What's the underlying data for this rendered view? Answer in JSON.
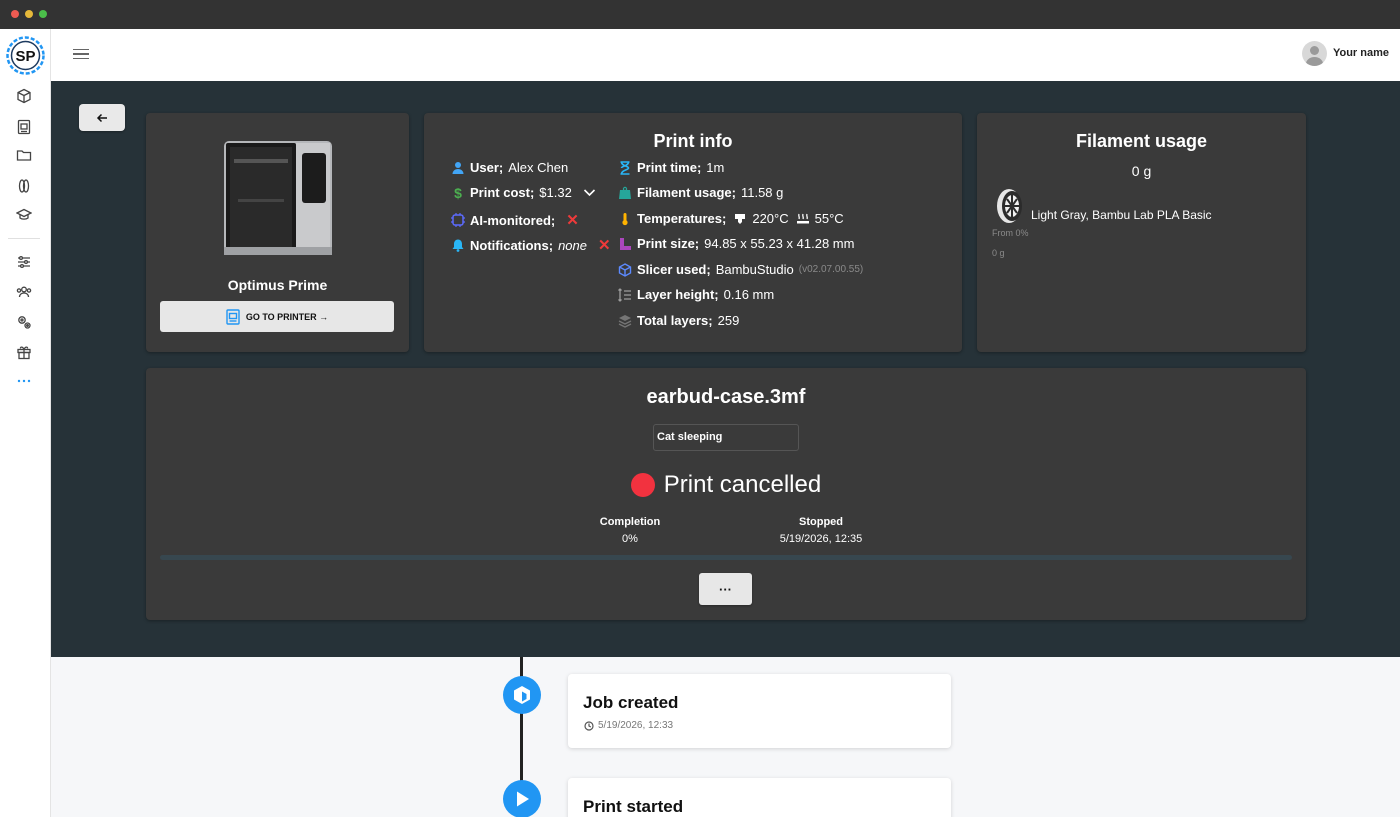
{
  "user": {
    "name": "Your name"
  },
  "printer": {
    "name": "Optimus Prime",
    "goto_label": "GO TO PRINTER →"
  },
  "print_info": {
    "title": "Print info",
    "user_label": "User;",
    "user_value": "Alex Chen",
    "cost_label": "Print cost;",
    "cost_value": "$1.32",
    "ai_label": "AI-monitored;",
    "notif_label": "Notifications;",
    "notif_value": "none",
    "time_label": "Print time;",
    "time_value": "1m",
    "filament_label": "Filament usage;",
    "filament_value": "11.58 g",
    "temp_label": "Temperatures;",
    "nozzle_temp": "220°C",
    "bed_temp": "55°C",
    "size_label": "Print size;",
    "size_value": "94.85 x 55.23 x 41.28 mm",
    "slicer_label": "Slicer used;",
    "slicer_value": "BambuStudio",
    "slicer_version": "(v02.07.00.55)",
    "layer_label": "Layer height;",
    "layer_value": "0.16 mm",
    "layers_label": "Total layers;",
    "layers_value": "259"
  },
  "filament": {
    "title": "Filament usage",
    "total": "0 g",
    "spool_name": "Light Gray, Bambu Lab PLA Basic",
    "from": "From 0%",
    "grams": "0 g"
  },
  "job": {
    "filename": "earbud-case.3mf",
    "note": "Cat sleeping",
    "status": "Print cancelled",
    "completion_label": "Completion",
    "completion_value": "0%",
    "stopped_label": "Stopped",
    "stopped_value": "5/19/2026, 12:35",
    "progress_fraction": 0,
    "more_label": "···"
  },
  "timeline": [
    {
      "title": "Job created",
      "time": "5/19/2026, 12:33"
    },
    {
      "title": "Print started"
    }
  ],
  "colors": {
    "accent": "#2196f3",
    "dark_bg": "#263238",
    "card_bg": "#3a3a3a",
    "status_cancelled": "#f2323f",
    "danger": "#ef3a3a"
  }
}
